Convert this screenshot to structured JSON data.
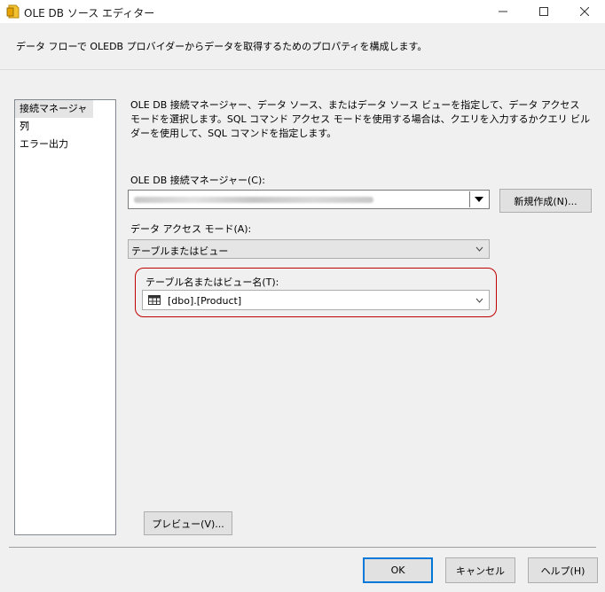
{
  "window": {
    "title": "OLE DB ソース エディター",
    "min_icon": "minimize-icon",
    "max_icon": "maximize-icon",
    "close_icon": "close-icon"
  },
  "header": {
    "description": "データ フローで OLEDB プロバイダーからデータを取得するためのプロパティを構成します。"
  },
  "nav": {
    "items": [
      {
        "label": "接続マネージャー",
        "selected": true
      },
      {
        "label": "列",
        "selected": false
      },
      {
        "label": "エラー出力",
        "selected": false
      }
    ]
  },
  "main": {
    "description": "OLE DB 接続マネージャー、データ ソース、またはデータ ソース ビューを指定して、データ アクセス モードを選択します。SQL コマンド アクセス モードを使用する場合は、クエリを入力するかクエリ ビルダーを使用して、SQL コマンドを指定します。",
    "connection_label": "OLE DB 接続マネージャー(C):",
    "connection_value": "",
    "new_button": "新規作成(N)...",
    "access_mode_label": "データ アクセス モード(A):",
    "access_mode_value": "テーブルまたはビュー",
    "table_label": "テーブル名またはビュー名(T):",
    "table_value": "[dbo].[Product]",
    "preview_button": "プレビュー(V)..."
  },
  "footer": {
    "ok": "OK",
    "cancel": "キャンセル",
    "help": "ヘルプ(H)"
  },
  "colors": {
    "highlight": "#c00000",
    "default_button_border": "#0078d7"
  }
}
